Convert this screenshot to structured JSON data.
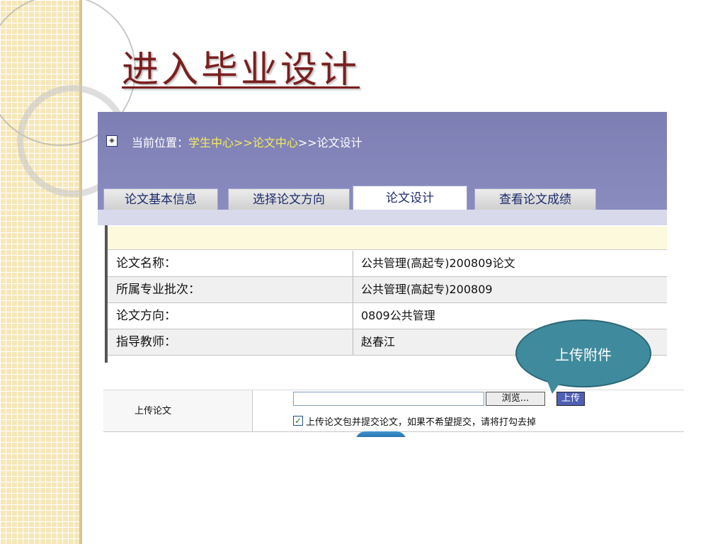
{
  "title": "进入毕业设计",
  "location": {
    "label": "当前位置：",
    "crumbs": [
      "学生中心",
      ">>",
      "论文中心",
      ">>",
      "论文设计"
    ]
  },
  "tabs": [
    {
      "label": "论文基本信息",
      "active": false
    },
    {
      "label": "选择论文方向",
      "active": false
    },
    {
      "label": "论文设计",
      "active": true
    },
    {
      "label": "查看论文成绩",
      "active": false
    }
  ],
  "details": [
    {
      "key": "论文名称：",
      "value": "公共管理(高起专)200809论文"
    },
    {
      "key": "所属专业批次：",
      "value": "公共管理(高起专)200809"
    },
    {
      "key": "论文方向：",
      "value": "0809公共管理"
    },
    {
      "key": "指导教师：",
      "value": "赵春江"
    }
  ],
  "callout": "上传附件",
  "upload": {
    "label": "上传论文",
    "browse": "浏览...",
    "submit": "上传",
    "checkbox_checked": true,
    "checkbox_label": "上传论文包并提交论文，如果不希望提交，请将打勾去掉"
  },
  "colors": {
    "title": "#7a1f1f",
    "header": "#8a8cc0",
    "crumb": "#f6ec5a",
    "callout": "#3f8b9d"
  }
}
